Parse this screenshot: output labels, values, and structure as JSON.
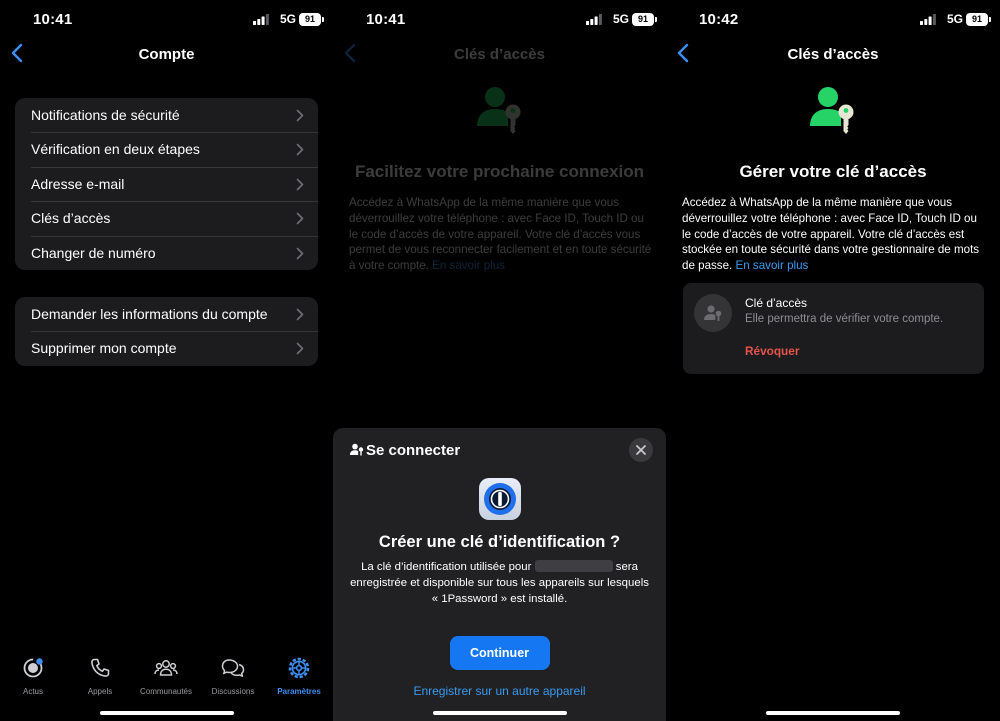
{
  "status_bars": [
    {
      "time": "10:41",
      "network": "5G",
      "battery": "91"
    },
    {
      "time": "10:41",
      "network": "5G",
      "battery": "91"
    },
    {
      "time": "10:42",
      "network": "5G",
      "battery": "91"
    }
  ],
  "account": {
    "title": "Compte",
    "group1": [
      "Notifications de sécurité",
      "Vérification en deux étapes",
      "Adresse e-mail",
      "Clés d’accès",
      "Changer de numéro"
    ],
    "group2": [
      "Demander les informations du compte",
      "Supprimer mon compte"
    ],
    "tabs": [
      {
        "label": "Actus",
        "icon": "updates-icon",
        "active": false
      },
      {
        "label": "Appels",
        "icon": "phone-icon",
        "active": false
      },
      {
        "label": "Communautés",
        "icon": "communities-icon",
        "active": false
      },
      {
        "label": "Discussions",
        "icon": "chats-icon",
        "active": false
      },
      {
        "label": "Paramètres",
        "icon": "settings-gear-icon",
        "active": true
      }
    ]
  },
  "intro": {
    "title": "Clés d’accès",
    "heading": "Facilitez votre prochaine connexion",
    "description": "Accédez à WhatsApp de la même manière que vous déverrouillez votre téléphone : avec Face ID, Touch ID ou le code d’accès de votre appareil. Votre clé d’accès vous permet de vous reconnecter facilement et en toute sécurité à votre compte.",
    "link": "En savoir plus"
  },
  "sheet": {
    "header": "Se connecter",
    "title": "Créer une clé d’identification ?",
    "text_before": "La clé d’identification utilisée pour",
    "text_after": "sera enregistrée et disponible sur tous les appareils sur lesquels « 1Password » est installé.",
    "primary_button": "Continuer",
    "secondary_link": "Enregistrer sur un autre appareil"
  },
  "manage": {
    "title": "Clés d’accès",
    "heading": "Gérer votre clé d’accès",
    "description": "Accédez à WhatsApp de la même manière que vous déverrouillez votre téléphone : avec Face ID, Touch ID ou le code d’accès de votre appareil. Votre clé d’accès est stockée en toute sécurité dans votre gestionnaire de mots de passe.",
    "link": "En savoir plus",
    "card": {
      "title": "Clé d’accès",
      "subtitle": "Elle permettra de vérifier votre compte.",
      "action": "Révoquer"
    }
  },
  "colors": {
    "accent_blue": "#3a9bf0",
    "button_blue": "#1677f2",
    "whatsapp_green": "#25d366",
    "destructive_red": "#e5544b",
    "cell_background": "#1c1c1e"
  }
}
